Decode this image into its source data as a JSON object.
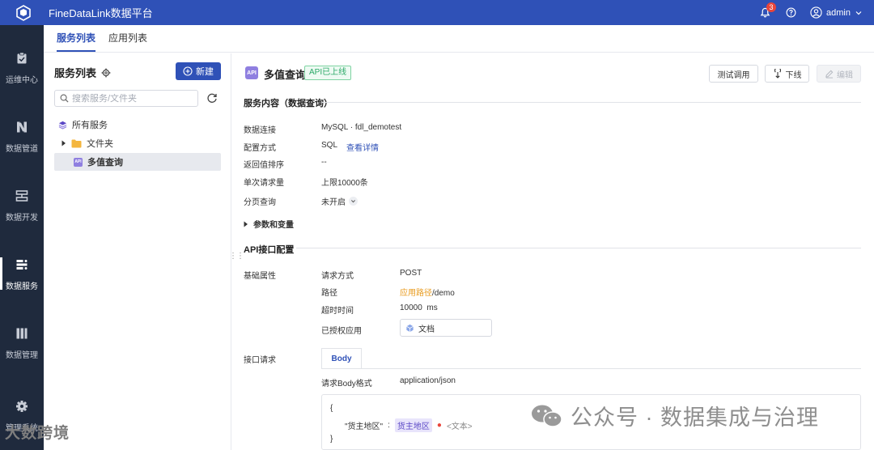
{
  "header": {
    "app_title": "FineDataLink数据平台",
    "notification_count": "3",
    "user_name": "admin"
  },
  "sidebar": {
    "items": [
      {
        "label": "运维中心"
      },
      {
        "label": "数据管道"
      },
      {
        "label": "数据开发"
      },
      {
        "label": "数据服务"
      },
      {
        "label": "数据管理"
      },
      {
        "label": "管理系统"
      }
    ]
  },
  "tabs": {
    "items": [
      {
        "label": "服务列表"
      },
      {
        "label": "应用列表"
      }
    ]
  },
  "left_panel": {
    "title": "服务列表",
    "new_button": "新建",
    "search_placeholder": "搜索服务/文件夹",
    "tree": {
      "root": "所有服务",
      "folder": "文件夹",
      "service": "多值查询"
    }
  },
  "detail": {
    "api_icon": "API",
    "title": "多值查询",
    "status": "API已上线",
    "buttons": {
      "test": "测试调用",
      "offline": "下线",
      "edit": "编辑"
    },
    "service_section": {
      "title": "服务内容（数据查询）",
      "rows": {
        "connection_label": "数据连接",
        "connection_value": "MySQL · fdl_demotest",
        "config_label": "配置方式",
        "config_value": "SQL",
        "config_link": "查看详情",
        "sort_label": "返回值排序",
        "sort_value": "--",
        "limit_label": "单次请求量",
        "limit_value": "上限10000条",
        "paging_label": "分页查询",
        "paging_value": "未开启"
      },
      "params_toggle": "参数和变量"
    },
    "api_section": {
      "title": "API接口配置",
      "basic_label": "基础属性",
      "method_label": "请求方式",
      "method_value": "POST",
      "path_label": "路径",
      "path_prefix": "应用路径",
      "path_value": "/demo",
      "timeout_label": "超时时间",
      "timeout_value": "10000",
      "timeout_unit": "ms",
      "auth_label": "已授权应用",
      "auth_app": "文档",
      "request_label": "接口请求",
      "body_tab": "Body",
      "body_format_label": "请求Body格式",
      "body_format_value": "application/json",
      "code": {
        "open": "{",
        "key": "\"货主地区\"",
        "colon": ":",
        "field": "货主地区",
        "type": "<文本>",
        "close": "}"
      }
    }
  },
  "watermark": {
    "text": "公众号 · 数据集成与治理",
    "logo_text": "大数跨境"
  }
}
